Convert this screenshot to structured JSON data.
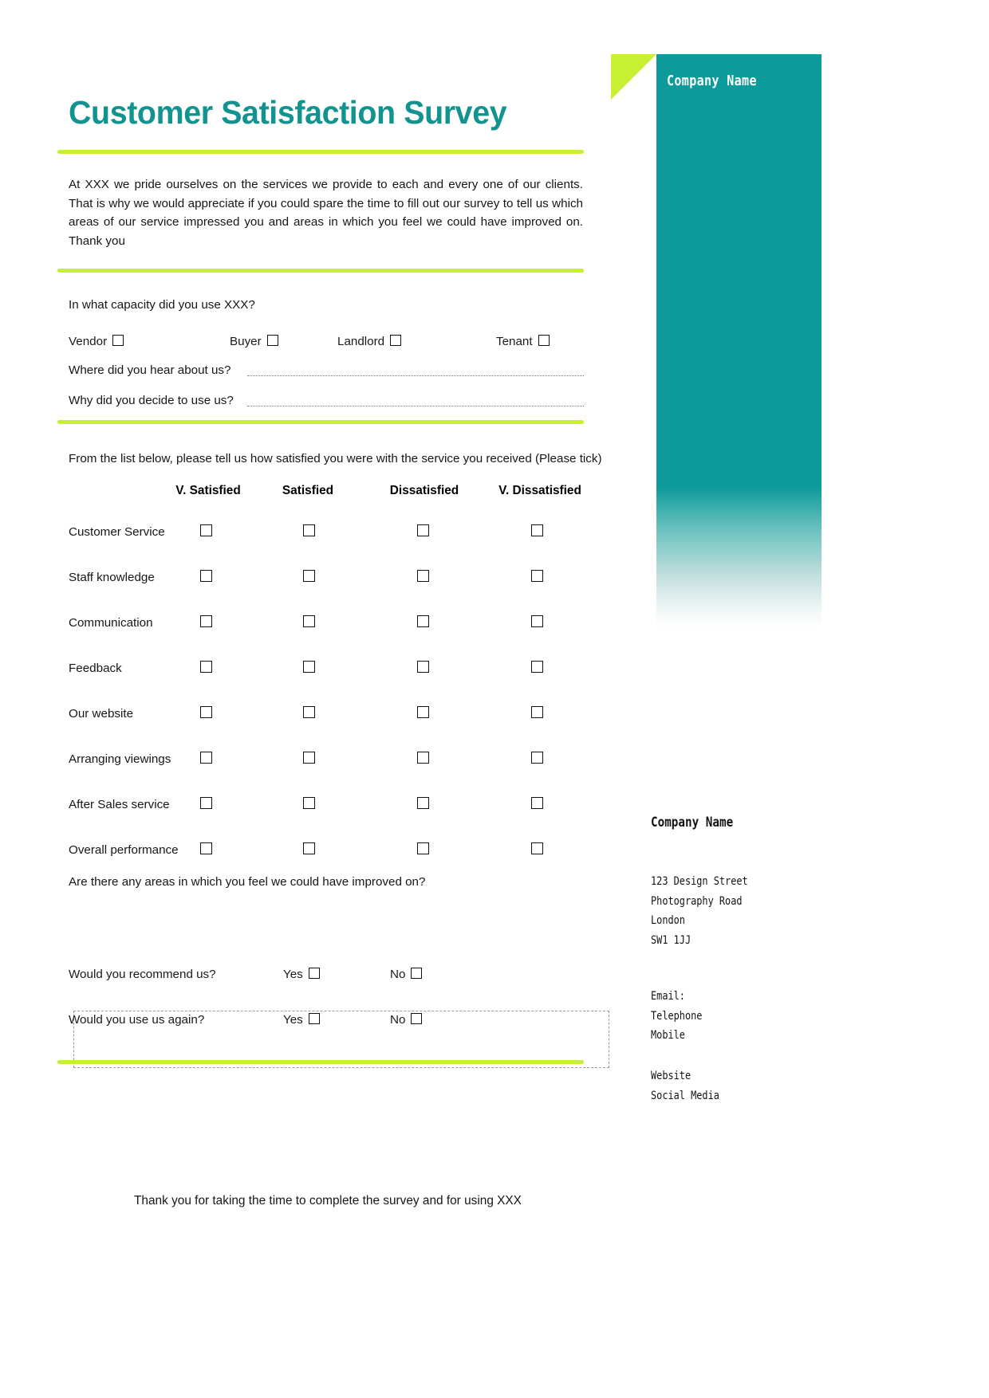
{
  "banner": {
    "company_name": "Company Name",
    "teal_color": "#0c9a9a",
    "lime_color": "#c7f032"
  },
  "header": {
    "title": "Customer Satisfaction Survey",
    "title_color": "#12938f"
  },
  "intro": {
    "paragraph": "At XXX we pride ourselves on the services we provide to each and every one of our clients. That is why we would appreciate if you could spare the time to fill out our survey to tell us which areas of our service impressed you and areas in which you feel we could have improved on. Thank you"
  },
  "capacity": {
    "question": "In what capacity did you use XXX?",
    "options": [
      {
        "label": "Vendor"
      },
      {
        "label": "Buyer"
      },
      {
        "label": "Landlord"
      },
      {
        "label": "Tenant"
      }
    ],
    "fill_ins": [
      {
        "label": "Where did you hear about us?"
      },
      {
        "label": "Why did you decide to use us?"
      }
    ]
  },
  "matrix": {
    "instruction": "From the list below, please tell us how satisfied you were with the service you received (Please tick)",
    "columns": [
      "V. Satisfied",
      "Satisfied",
      "Dissatisfied",
      "V. Dissatisfied"
    ],
    "rows": [
      "Customer Service",
      "Staff knowledge",
      "Communication",
      "Feedback",
      "Our website",
      "Arranging viewings",
      "After Sales service",
      "Overall performance"
    ]
  },
  "improve": {
    "question": "Are there any areas in which you feel we could have improved on?",
    "answer": ""
  },
  "yesno": {
    "yes_label": "Yes",
    "no_label": "No",
    "questions": [
      "Would you recommend us?",
      "Would you use us again?"
    ]
  },
  "footer": {
    "thank_you": "Thank you for taking the time to complete the survey and for using XXX"
  },
  "contact": {
    "company_name": "Company Name",
    "address": [
      "123 Design Street",
      "Photography Road",
      "London",
      "SW1 1JJ"
    ],
    "comms": [
      "Email:",
      "Telephone",
      "Mobile"
    ],
    "web": [
      "Website",
      "Social Media"
    ]
  }
}
